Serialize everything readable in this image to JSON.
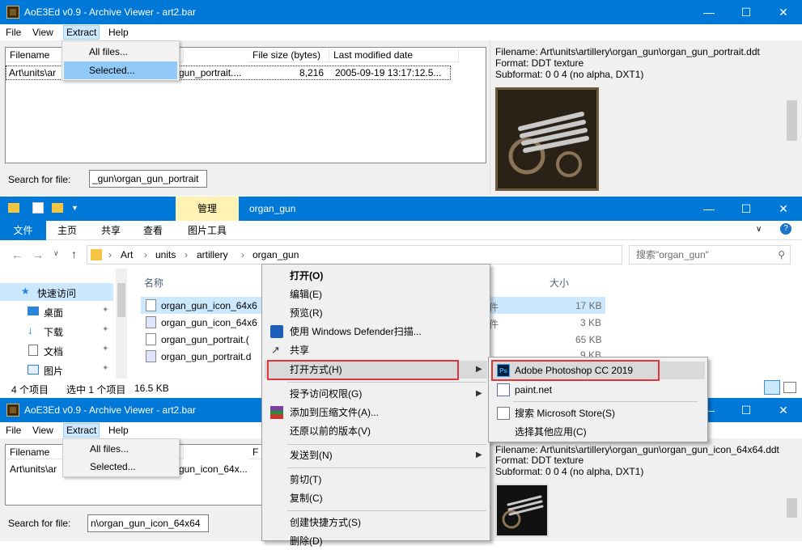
{
  "top_window": {
    "title": "AoE3Ed v0.9 - Archive Viewer - art2.bar",
    "menu": [
      "File",
      "View",
      "Extract",
      "Help"
    ],
    "extract_menu": [
      "All files...",
      "Selected..."
    ],
    "columns": [
      "Filename",
      "File size (bytes)",
      "Last modified date"
    ],
    "row": {
      "filename": "Art\\units\\ar",
      "filename_tail": "gun_portrait....",
      "size": "8,216",
      "date": "2005-09-19 13:17:12.5..."
    },
    "search_label": "Search for file:",
    "search_value": "_gun\\organ_gun_portrait",
    "info": {
      "filename": "Filename: Art\\units\\artillery\\organ_gun\\organ_gun_portrait.ddt",
      "format": "Format: DDT texture",
      "subformat": "Subformat: 0 0 4 (no alpha, DXT1)"
    }
  },
  "explorer": {
    "title": "organ_gun",
    "ribbon_context_tab": "管理",
    "tabs": [
      "文件",
      "主页",
      "共享",
      "查看",
      "图片工具"
    ],
    "breadcrumb": [
      "Art",
      "units",
      "artillery",
      "organ_gun"
    ],
    "search_placeholder": "搜索\"organ_gun\"",
    "col_name": "名称",
    "col_size": "大小",
    "nav": [
      {
        "label": "快速访问"
      },
      {
        "label": "桌面"
      },
      {
        "label": "下载"
      },
      {
        "label": "文档"
      },
      {
        "label": "图片"
      }
    ],
    "files": [
      {
        "name": "organ_gun_icon_64x6",
        "size": "17 KB"
      },
      {
        "name": "organ_gun_icon_64x6",
        "size": "3 KB"
      },
      {
        "name": "organ_gun_portrait.(",
        "size": "65 KB"
      },
      {
        "name": "organ_gun_portrait.d",
        "size": "9 KB"
      }
    ],
    "type_fragment": "件",
    "status": {
      "count": "4 个项目",
      "selected": "选中 1 个项目",
      "size": "16.5 KB"
    }
  },
  "context_menu": {
    "items": [
      "打开(O)",
      "编辑(E)",
      "预览(R)",
      "使用 Windows Defender扫描...",
      "共享",
      "打开方式(H)",
      "授予访问权限(G)",
      "添加到压缩文件(A)...",
      "还原以前的版本(V)",
      "发送到(N)",
      "剪切(T)",
      "复制(C)",
      "创建快捷方式(S)",
      "删除(D)"
    ]
  },
  "open_with_menu": {
    "items": [
      "Adobe Photoshop CC 2019",
      "paint.net",
      "搜索 Microsoft Store(S)",
      "选择其他应用(C)"
    ],
    "ps_glyph": "Ps"
  },
  "bottom_window": {
    "title": "AoE3Ed v0.9 - Archive Viewer - art2.bar",
    "menu": [
      "File",
      "View",
      "Extract",
      "Help"
    ],
    "extract_menu": [
      "All files...",
      "Selected..."
    ],
    "columns": [
      "Filename",
      "F"
    ],
    "row": {
      "filename": "Art\\units\\ar",
      "filename_tail": "gun_icon_64x..."
    },
    "search_label": "Search for file:",
    "search_value": "n\\organ_gun_icon_64x64",
    "info": {
      "filename": "Filename: Art\\units\\artillery\\organ_gun\\organ_gun_icon_64x64.ddt",
      "format": "Format: DDT texture",
      "subformat": "Subformat: 0 0 4 (no alpha, DXT1)"
    }
  },
  "colors": {
    "titlebar": "#0078d7",
    "highlight": "#cce8ff",
    "red_box": "#e0353b",
    "ribbon_tab": "#fff2b3"
  }
}
